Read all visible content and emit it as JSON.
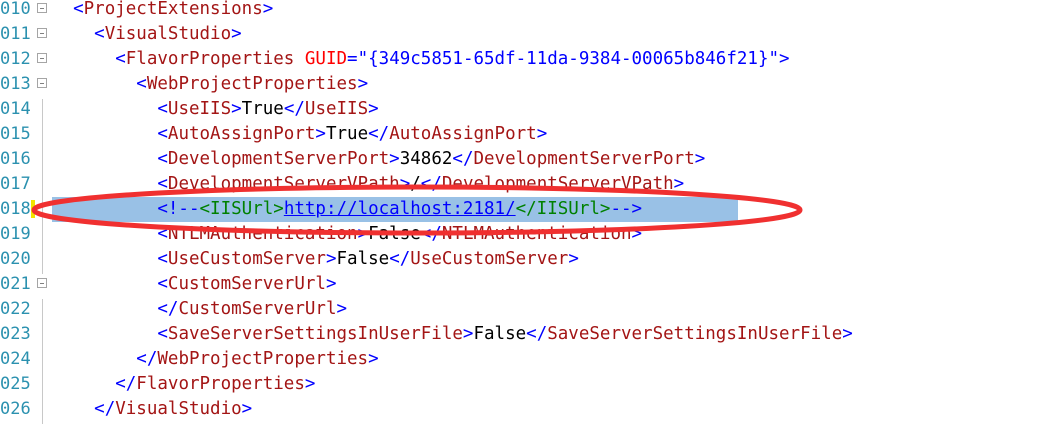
{
  "editor": {
    "lines": [
      {
        "num": "010",
        "indent": "  ",
        "parts": [
          {
            "cls": "d",
            "text": "<"
          },
          {
            "cls": "t",
            "text": "ProjectExtensions"
          },
          {
            "cls": "d",
            "text": ">"
          }
        ]
      },
      {
        "num": "011",
        "indent": "    ",
        "parts": [
          {
            "cls": "d",
            "text": "<"
          },
          {
            "cls": "t",
            "text": "VisualStudio"
          },
          {
            "cls": "d",
            "text": ">"
          }
        ]
      },
      {
        "num": "012",
        "indent": "      ",
        "parts": [
          {
            "cls": "d",
            "text": "<"
          },
          {
            "cls": "t",
            "text": "FlavorProperties"
          },
          {
            "cls": "x",
            "text": " "
          },
          {
            "cls": "a",
            "text": "GUID"
          },
          {
            "cls": "d",
            "text": "=\""
          },
          {
            "cls": "v",
            "text": "{349c5851-65df-11da-9384-00065b846f21}"
          },
          {
            "cls": "d",
            "text": "\">"
          }
        ]
      },
      {
        "num": "013",
        "indent": "        ",
        "parts": [
          {
            "cls": "d",
            "text": "<"
          },
          {
            "cls": "t",
            "text": "WebProjectProperties"
          },
          {
            "cls": "d",
            "text": ">"
          }
        ]
      },
      {
        "num": "014",
        "indent": "          ",
        "parts": [
          {
            "cls": "d",
            "text": "<"
          },
          {
            "cls": "t",
            "text": "UseIIS"
          },
          {
            "cls": "d",
            "text": ">"
          },
          {
            "cls": "x",
            "text": "True"
          },
          {
            "cls": "d",
            "text": "</"
          },
          {
            "cls": "t",
            "text": "UseIIS"
          },
          {
            "cls": "d",
            "text": ">"
          }
        ]
      },
      {
        "num": "015",
        "indent": "          ",
        "parts": [
          {
            "cls": "d",
            "text": "<"
          },
          {
            "cls": "t",
            "text": "AutoAssignPort"
          },
          {
            "cls": "d",
            "text": ">"
          },
          {
            "cls": "x",
            "text": "True"
          },
          {
            "cls": "d",
            "text": "</"
          },
          {
            "cls": "t",
            "text": "AutoAssignPort"
          },
          {
            "cls": "d",
            "text": ">"
          }
        ]
      },
      {
        "num": "016",
        "indent": "          ",
        "parts": [
          {
            "cls": "d",
            "text": "<"
          },
          {
            "cls": "t",
            "text": "DevelopmentServerPort"
          },
          {
            "cls": "d",
            "text": ">"
          },
          {
            "cls": "x",
            "text": "34862"
          },
          {
            "cls": "d",
            "text": "</"
          },
          {
            "cls": "t",
            "text": "DevelopmentServerPort"
          },
          {
            "cls": "d",
            "text": ">"
          }
        ]
      },
      {
        "num": "017",
        "indent": "          ",
        "parts": [
          {
            "cls": "d",
            "text": "<"
          },
          {
            "cls": "t",
            "text": "DevelopmentServerVPath"
          },
          {
            "cls": "d",
            "text": ">"
          },
          {
            "cls": "x",
            "text": "/"
          },
          {
            "cls": "d",
            "text": "</"
          },
          {
            "cls": "t",
            "text": "DevelopmentServerVPath"
          },
          {
            "cls": "d",
            "text": ">"
          }
        ]
      },
      {
        "num": "018",
        "indent": "          ",
        "selected": true,
        "parts": [
          {
            "cls": "d",
            "text": "<!--"
          },
          {
            "cls": "c",
            "text": "<IISUrl>"
          },
          {
            "cls": "u",
            "text": "http://localhost:2181/"
          },
          {
            "cls": "c",
            "text": "</IISUrl>"
          },
          {
            "cls": "d",
            "text": "-->"
          }
        ]
      },
      {
        "num": "019",
        "indent": "          ",
        "parts": [
          {
            "cls": "d",
            "text": "<"
          },
          {
            "cls": "t",
            "text": "NTLMAuthentication"
          },
          {
            "cls": "d",
            "text": ">"
          },
          {
            "cls": "x",
            "text": "False"
          },
          {
            "cls": "d",
            "text": "</"
          },
          {
            "cls": "t",
            "text": "NTLMAuthentication"
          },
          {
            "cls": "d",
            "text": ">"
          }
        ]
      },
      {
        "num": "020",
        "indent": "          ",
        "parts": [
          {
            "cls": "d",
            "text": "<"
          },
          {
            "cls": "t",
            "text": "UseCustomServer"
          },
          {
            "cls": "d",
            "text": ">"
          },
          {
            "cls": "x",
            "text": "False"
          },
          {
            "cls": "d",
            "text": "</"
          },
          {
            "cls": "t",
            "text": "UseCustomServer"
          },
          {
            "cls": "d",
            "text": ">"
          }
        ]
      },
      {
        "num": "021",
        "indent": "          ",
        "parts": [
          {
            "cls": "d",
            "text": "<"
          },
          {
            "cls": "t",
            "text": "CustomServerUrl"
          },
          {
            "cls": "d",
            "text": ">"
          }
        ]
      },
      {
        "num": "022",
        "indent": "          ",
        "parts": [
          {
            "cls": "d",
            "text": "</"
          },
          {
            "cls": "t",
            "text": "CustomServerUrl"
          },
          {
            "cls": "d",
            "text": ">"
          }
        ]
      },
      {
        "num": "023",
        "indent": "          ",
        "parts": [
          {
            "cls": "d",
            "text": "<"
          },
          {
            "cls": "t",
            "text": "SaveServerSettingsInUserFile"
          },
          {
            "cls": "d",
            "text": ">"
          },
          {
            "cls": "x",
            "text": "False"
          },
          {
            "cls": "d",
            "text": "</"
          },
          {
            "cls": "t",
            "text": "SaveServerSettingsInUserFile"
          },
          {
            "cls": "d",
            "text": ">"
          }
        ]
      },
      {
        "num": "024",
        "indent": "        ",
        "parts": [
          {
            "cls": "d",
            "text": "</"
          },
          {
            "cls": "t",
            "text": "WebProjectProperties"
          },
          {
            "cls": "d",
            "text": ">"
          }
        ]
      },
      {
        "num": "025",
        "indent": "      ",
        "parts": [
          {
            "cls": "d",
            "text": "</"
          },
          {
            "cls": "t",
            "text": "FlavorProperties"
          },
          {
            "cls": "d",
            "text": ">"
          }
        ]
      },
      {
        "num": "026",
        "indent": "    ",
        "parts": [
          {
            "cls": "d",
            "text": "</"
          },
          {
            "cls": "t",
            "text": "VisualStudio"
          },
          {
            "cls": "d",
            "text": ">"
          }
        ]
      }
    ],
    "fold_boxes": [
      "010",
      "011",
      "012",
      "013",
      "021"
    ],
    "colors": {
      "delimiter": "#0000ff",
      "tag_name": "#a31515",
      "attribute": "#ff0000",
      "attribute_value": "#0000ff",
      "text": "#000000",
      "comment": "#008000",
      "line_number": "#2b91af",
      "selection": "#99c1e6",
      "annotation_ellipse": "#f03030",
      "change_marker": "#f2e400"
    }
  }
}
